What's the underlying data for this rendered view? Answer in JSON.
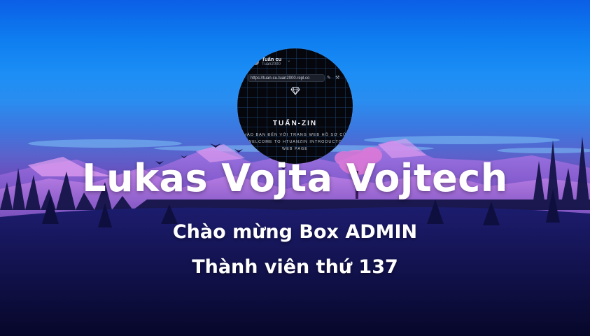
{
  "background": {
    "description_colors": {
      "sky_top": "#0b5fe6",
      "sky_mid": "#2a8df0",
      "mountain": "#8a5fd6",
      "forest": "#0d0b3a"
    }
  },
  "avatar": {
    "user_name": "Tuấn cu",
    "user_handle": "Tuan2000",
    "url": "https://tuan-cu.tuan2000.repl.co",
    "brand": "TUẤN-ZIN",
    "line1": "CHÀO BẠN ĐẾN VỚI TRANG WEB HỒ SƠ CỦA",
    "line2": "WELCOME TO HTUANZIN INTRODUCTO",
    "line3": "WEB PAGE"
  },
  "title": "Lukas Vojta Vojtech",
  "subtitle": "Chào mừng Box ADMIN",
  "member_line": "Thành viên thứ  137"
}
